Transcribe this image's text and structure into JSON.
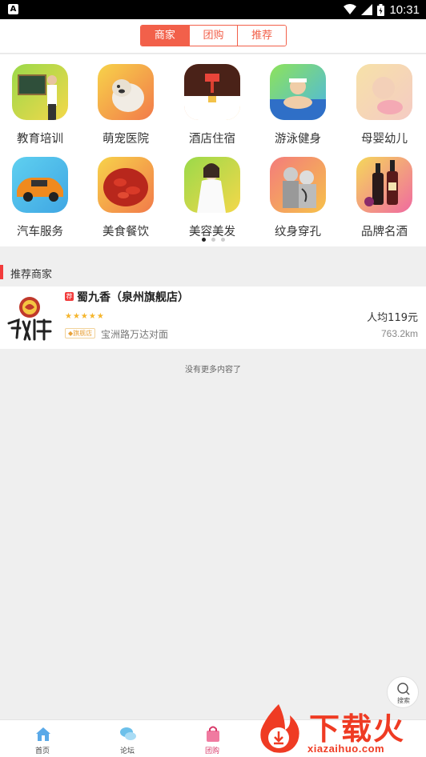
{
  "status_bar": {
    "time": "10:31",
    "app_icon": "A"
  },
  "segments": {
    "items": [
      "商家",
      "团购",
      "推荐"
    ],
    "active": 0
  },
  "categories": [
    {
      "label": "教育培训",
      "icon": "teacher-photo"
    },
    {
      "label": "萌宠医院",
      "icon": "bulldog-photo"
    },
    {
      "label": "酒店住宿",
      "icon": "hotel-room-photo"
    },
    {
      "label": "游泳健身",
      "icon": "swimmer-photo"
    },
    {
      "label": "母婴幼儿",
      "icon": "baby-photo"
    },
    {
      "label": "汽车服务",
      "icon": "car-photo"
    },
    {
      "label": "美食餐饮",
      "icon": "crayfish-photo"
    },
    {
      "label": "美容美发",
      "icon": "beauty-photo"
    },
    {
      "label": "纹身穿孔",
      "icon": "tattoo-photo"
    },
    {
      "label": "品牌名酒",
      "icon": "wine-photo"
    }
  ],
  "pager": {
    "pages": 3,
    "current": 0
  },
  "section": {
    "title": "推荐商家"
  },
  "merchant": {
    "badge": "荐",
    "name": "蜀九香（泉州旗舰店）",
    "rating": 5,
    "stars": "★★★★★",
    "price": "人均119元",
    "flag": "旗舰店",
    "address": "宝洲路万达对面",
    "distance": "763.2km"
  },
  "no_more": "没有更多内容了",
  "fab": {
    "label": "搜索"
  },
  "tabs": [
    {
      "label": "首页",
      "icon": "home-icon"
    },
    {
      "label": "论坛",
      "icon": "chat-bubbles-icon"
    },
    {
      "label": "团购",
      "icon": "shopping-bag-icon"
    }
  ],
  "active_tab": 2,
  "watermark": {
    "text": "下载火",
    "url": "xiazaihuo.com"
  },
  "colors": {
    "accent": "#f2604a",
    "red": "#f23b3b",
    "tab_active": "#d83b6a",
    "background": "#efefef"
  }
}
